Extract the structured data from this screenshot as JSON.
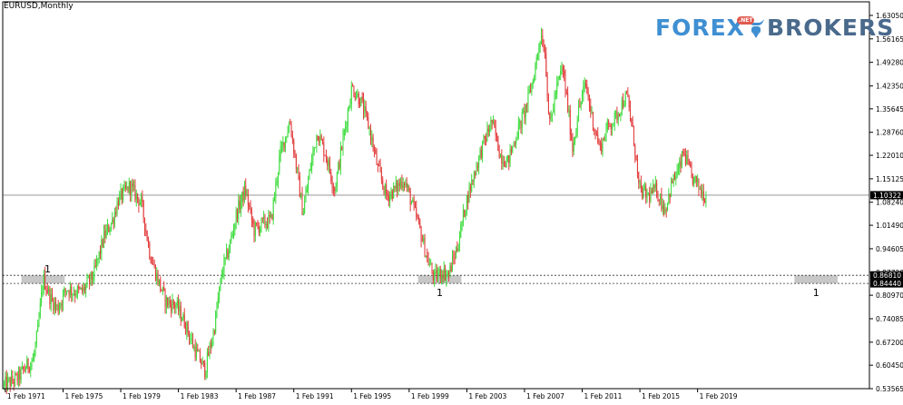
{
  "window": {
    "title": "EURUSD,Monthly"
  },
  "logo": {
    "text_left": "FOREX",
    "text_right": "BROKERS",
    "badge": ".NET",
    "color_left": "#3f8fd2",
    "color_right": "#4a6a8c",
    "color_badge": "#e05a4f"
  },
  "colors": {
    "background": "#ffffff",
    "bull": "#3ddc3d",
    "bear": "#e23b3b",
    "axis": "#000000",
    "grid_line": "#888888",
    "zone": "#bdbdbd",
    "price_label_bg": "#000000",
    "price_label_text": "#ffffff"
  },
  "chart_data": {
    "type": "candlestick",
    "symbol": "EURUSD",
    "timeframe": "Monthly",
    "ylim": [
      0.5357,
      1.665
    ],
    "y_ticks": [
      "1.63050",
      "1.56165",
      "1.49280",
      "1.42350",
      "1.35645",
      "1.28760",
      "1.22010",
      "1.15125",
      "1.08240",
      "1.01490",
      "0.94605",
      "0.87720",
      "0.80970",
      "0.74085",
      "0.67200",
      "0.60450",
      "0.53565"
    ],
    "x_ticks": [
      "1 Feb 1971",
      "1 Feb 1975",
      "1 Feb 1979",
      "1 Feb 1983",
      "1 Feb 1987",
      "1 Feb 1991",
      "1 Feb 1995",
      "1 Feb 1999",
      "1 Feb 2003",
      "1 Feb 2007",
      "1 Feb 2011",
      "1 Feb 2015",
      "1 Feb 2019"
    ],
    "x_range_years": [
      1970.9,
      2031.0
    ],
    "current_price": "1.10322",
    "horizontal_levels": [
      {
        "label": "0.86810",
        "value": 0.8681,
        "style": "dotted"
      },
      {
        "label": "0.84440",
        "value": 0.8444,
        "style": "dotted"
      }
    ],
    "zones": [
      {
        "x0": 1972.2,
        "x1": 1975.2,
        "y0": 0.8444,
        "y1": 0.8681,
        "label": "1",
        "label_pos": "above"
      },
      {
        "x0": 1999.7,
        "x1": 2002.7,
        "y0": 0.8444,
        "y1": 0.8681,
        "label": "1",
        "label_pos": "below"
      },
      {
        "x0": 2025.8,
        "x1": 2028.8,
        "y0": 0.8444,
        "y1": 0.8681,
        "label": "1",
        "label_pos": "below"
      }
    ],
    "price_path": [
      [
        1971.0,
        0.545
      ],
      [
        1972.0,
        0.565
      ],
      [
        1972.6,
        0.6
      ],
      [
        1973.1,
        0.62
      ],
      [
        1973.4,
        0.7
      ],
      [
        1973.8,
        0.86
      ],
      [
        1974.3,
        0.8
      ],
      [
        1974.8,
        0.77
      ],
      [
        1975.4,
        0.83
      ],
      [
        1975.9,
        0.82
      ],
      [
        1976.5,
        0.82
      ],
      [
        1977.3,
        0.87
      ],
      [
        1978.0,
        0.98
      ],
      [
        1978.6,
        1.03
      ],
      [
        1979.0,
        1.09
      ],
      [
        1979.8,
        1.13
      ],
      [
        1980.1,
        1.11
      ],
      [
        1980.6,
        1.08
      ],
      [
        1981.2,
        0.93
      ],
      [
        1981.7,
        0.86
      ],
      [
        1982.3,
        0.79
      ],
      [
        1983.0,
        0.78
      ],
      [
        1983.6,
        0.73
      ],
      [
        1984.2,
        0.66
      ],
      [
        1985.0,
        0.59
      ],
      [
        1985.6,
        0.7
      ],
      [
        1986.2,
        0.88
      ],
      [
        1986.7,
        0.95
      ],
      [
        1987.2,
        1.05
      ],
      [
        1987.8,
        1.12
      ],
      [
        1988.4,
        1.0
      ],
      [
        1989.0,
        1.02
      ],
      [
        1989.6,
        1.03
      ],
      [
        1990.2,
        1.22
      ],
      [
        1990.9,
        1.32
      ],
      [
        1991.3,
        1.2
      ],
      [
        1991.8,
        1.05
      ],
      [
        1992.3,
        1.18
      ],
      [
        1992.8,
        1.29
      ],
      [
        1993.4,
        1.22
      ],
      [
        1994.0,
        1.12
      ],
      [
        1994.6,
        1.27
      ],
      [
        1995.2,
        1.42
      ],
      [
        1995.8,
        1.38
      ],
      [
        1996.4,
        1.3
      ],
      [
        1997.0,
        1.18
      ],
      [
        1997.6,
        1.1
      ],
      [
        1998.2,
        1.12
      ],
      [
        1998.8,
        1.15
      ],
      [
        1999.2,
        1.1
      ],
      [
        1999.8,
        1.02
      ],
      [
        2000.4,
        0.92
      ],
      [
        2000.9,
        0.86
      ],
      [
        2001.4,
        0.88
      ],
      [
        2001.9,
        0.87
      ],
      [
        2002.5,
        0.95
      ],
      [
        2003.1,
        1.08
      ],
      [
        2003.7,
        1.17
      ],
      [
        2004.2,
        1.24
      ],
      [
        2004.9,
        1.32
      ],
      [
        2005.5,
        1.22
      ],
      [
        2006.0,
        1.2
      ],
      [
        2006.6,
        1.28
      ],
      [
        2007.2,
        1.35
      ],
      [
        2007.8,
        1.45
      ],
      [
        2008.3,
        1.58
      ],
      [
        2008.6,
        1.52
      ],
      [
        2008.9,
        1.3
      ],
      [
        2009.3,
        1.4
      ],
      [
        2009.8,
        1.48
      ],
      [
        2010.2,
        1.35
      ],
      [
        2010.5,
        1.24
      ],
      [
        2010.9,
        1.35
      ],
      [
        2011.4,
        1.43
      ],
      [
        2011.9,
        1.32
      ],
      [
        2012.4,
        1.24
      ],
      [
        2012.9,
        1.3
      ],
      [
        2013.5,
        1.33
      ],
      [
        2014.0,
        1.38
      ],
      [
        2014.3,
        1.39
      ],
      [
        2014.8,
        1.25
      ],
      [
        2015.1,
        1.12
      ],
      [
        2015.7,
        1.1
      ],
      [
        2016.3,
        1.12
      ],
      [
        2016.9,
        1.06
      ],
      [
        2017.4,
        1.14
      ],
      [
        2017.9,
        1.18
      ],
      [
        2018.2,
        1.23
      ],
      [
        2018.7,
        1.16
      ],
      [
        2019.2,
        1.13
      ],
      [
        2019.7,
        1.1
      ]
    ]
  }
}
